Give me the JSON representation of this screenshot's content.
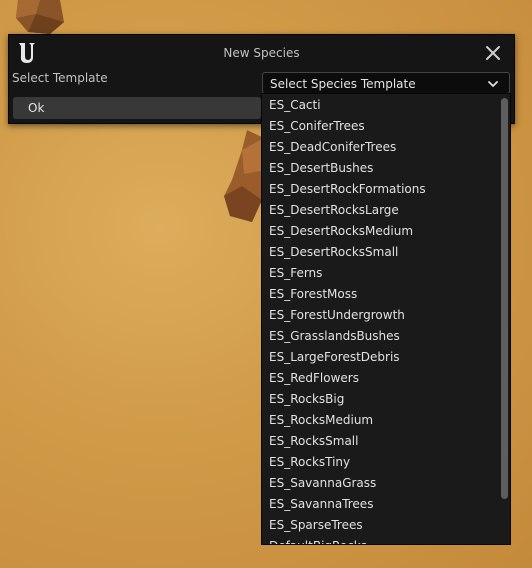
{
  "dialog": {
    "title": "New Species",
    "select_label": "Select Template",
    "combo_placeholder": "Select Species Template",
    "ok_label": "Ok"
  },
  "dropdown": {
    "items": [
      "ES_Cacti",
      "ES_ConiferTrees",
      "ES_DeadConiferTrees",
      "ES_DesertBushes",
      "ES_DesertRockFormations",
      "ES_DesertRocksLarge",
      "ES_DesertRocksMedium",
      "ES_DesertRocksSmall",
      "ES_Ferns",
      "ES_ForestMoss",
      "ES_ForestUndergrowth",
      "ES_GrasslandsBushes",
      "ES_LargeForestDebris",
      "ES_RedFlowers",
      "ES_RocksBig",
      "ES_RocksMedium",
      "ES_RocksSmall",
      "ES_RocksTiny",
      "ES_SavannaGrass",
      "ES_SavannaTrees",
      "ES_SparseTrees",
      "DefaultBigRocks"
    ]
  },
  "icons": {
    "logo": "unreal-logo-icon",
    "close": "close-icon",
    "chevron": "chevron-down-icon"
  }
}
